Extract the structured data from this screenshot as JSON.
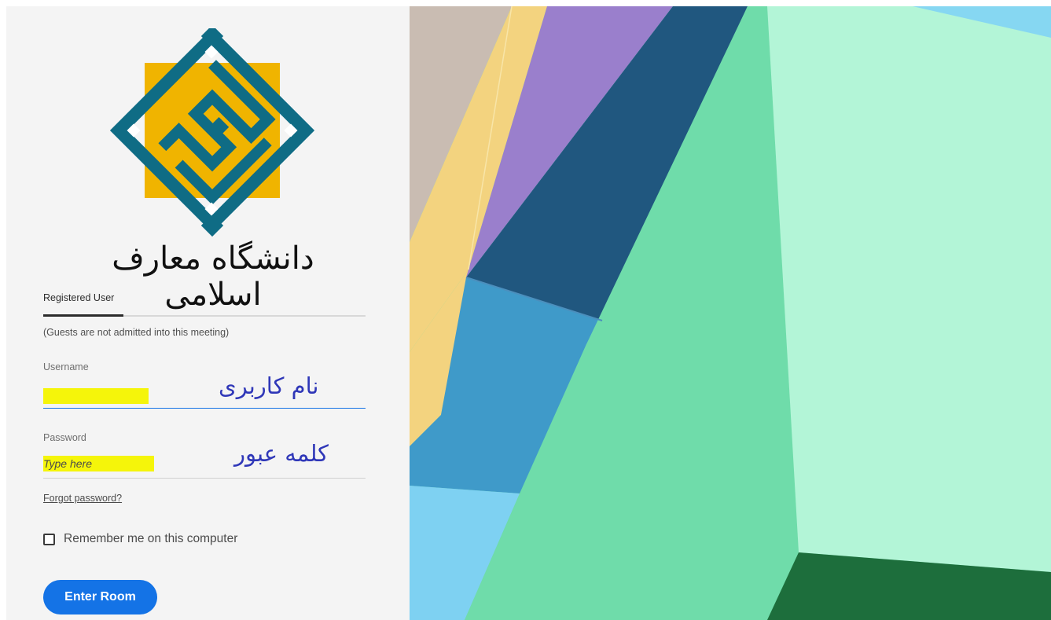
{
  "logo": {
    "caption": "دانشگاه معارف اسلامی",
    "colors": {
      "square": "#f0b400",
      "diamond": "#0f6c85",
      "background": "#f4f4f4"
    }
  },
  "tabs": {
    "registered_label": "Registered User"
  },
  "guest_note": "(Guests are not admitted into this meeting)",
  "username": {
    "label": "Username",
    "value": "",
    "annotation": "نام کاربری"
  },
  "password": {
    "label": "Password",
    "placeholder": "Type here",
    "annotation": "کلمه عبور"
  },
  "forgot_link": "Forgot password?",
  "remember": {
    "label": "Remember me on this computer",
    "checked": false
  },
  "enter_button": "Enter Room",
  "colors": {
    "accent": "#1473e6",
    "highlight": "#f5f50a",
    "annotation_ink": "#2f37b8"
  }
}
